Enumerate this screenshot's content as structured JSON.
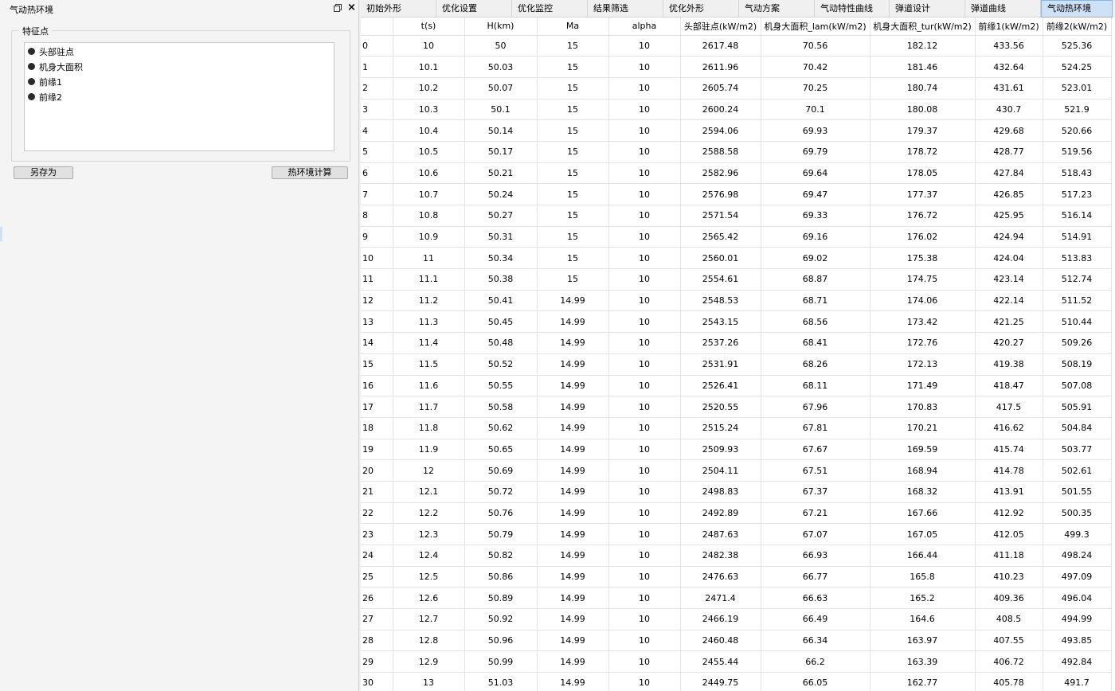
{
  "dock": {
    "title": "气动热环境",
    "group_title": "特征点",
    "items": [
      "头部驻点",
      "机身大面积",
      "前缘1",
      "前缘2"
    ],
    "save_as_label": "另存为",
    "calc_label": "热环境计算"
  },
  "tabs": [
    "初始外形",
    "优化设置",
    "优化监控",
    "结果筛选",
    "优化外形",
    "气动方案",
    "气动特性曲线",
    "弹道设计",
    "弹道曲线",
    "气动热环境"
  ],
  "active_tab": "气动热环境",
  "table": {
    "columns": [
      "",
      "t(s)",
      "H(km)",
      "Ma",
      "alpha",
      "头部驻点(kW/m2)",
      "机身大面积_lam(kW/m2)",
      "机身大面积_tur(kW/m2)",
      "前缘1(kW/m2)",
      "前缘2(kW/m2)"
    ],
    "rows": [
      [
        "0",
        "10",
        "50",
        "15",
        "10",
        "2617.48",
        "70.56",
        "182.12",
        "433.56",
        "525.36"
      ],
      [
        "1",
        "10.1",
        "50.03",
        "15",
        "10",
        "2611.96",
        "70.42",
        "181.46",
        "432.64",
        "524.25"
      ],
      [
        "2",
        "10.2",
        "50.07",
        "15",
        "10",
        "2605.74",
        "70.25",
        "180.74",
        "431.61",
        "523.01"
      ],
      [
        "3",
        "10.3",
        "50.1",
        "15",
        "10",
        "2600.24",
        "70.1",
        "180.08",
        "430.7",
        "521.9"
      ],
      [
        "4",
        "10.4",
        "50.14",
        "15",
        "10",
        "2594.06",
        "69.93",
        "179.37",
        "429.68",
        "520.66"
      ],
      [
        "5",
        "10.5",
        "50.17",
        "15",
        "10",
        "2588.58",
        "69.79",
        "178.72",
        "428.77",
        "519.56"
      ],
      [
        "6",
        "10.6",
        "50.21",
        "15",
        "10",
        "2582.96",
        "69.64",
        "178.05",
        "427.84",
        "518.43"
      ],
      [
        "7",
        "10.7",
        "50.24",
        "15",
        "10",
        "2576.98",
        "69.47",
        "177.37",
        "426.85",
        "517.23"
      ],
      [
        "8",
        "10.8",
        "50.27",
        "15",
        "10",
        "2571.54",
        "69.33",
        "176.72",
        "425.95",
        "516.14"
      ],
      [
        "9",
        "10.9",
        "50.31",
        "15",
        "10",
        "2565.42",
        "69.16",
        "176.02",
        "424.94",
        "514.91"
      ],
      [
        "10",
        "11",
        "50.34",
        "15",
        "10",
        "2560.01",
        "69.02",
        "175.38",
        "424.04",
        "513.83"
      ],
      [
        "11",
        "11.1",
        "50.38",
        "15",
        "10",
        "2554.61",
        "68.87",
        "174.75",
        "423.14",
        "512.74"
      ],
      [
        "12",
        "11.2",
        "50.41",
        "14.99",
        "10",
        "2548.53",
        "68.71",
        "174.06",
        "422.14",
        "511.52"
      ],
      [
        "13",
        "11.3",
        "50.45",
        "14.99",
        "10",
        "2543.15",
        "68.56",
        "173.42",
        "421.25",
        "510.44"
      ],
      [
        "14",
        "11.4",
        "50.48",
        "14.99",
        "10",
        "2537.26",
        "68.41",
        "172.76",
        "420.27",
        "509.26"
      ],
      [
        "15",
        "11.5",
        "50.52",
        "14.99",
        "10",
        "2531.91",
        "68.26",
        "172.13",
        "419.38",
        "508.19"
      ],
      [
        "16",
        "11.6",
        "50.55",
        "14.99",
        "10",
        "2526.41",
        "68.11",
        "171.49",
        "418.47",
        "507.08"
      ],
      [
        "17",
        "11.7",
        "50.58",
        "14.99",
        "10",
        "2520.55",
        "67.96",
        "170.83",
        "417.5",
        "505.91"
      ],
      [
        "18",
        "11.8",
        "50.62",
        "14.99",
        "10",
        "2515.24",
        "67.81",
        "170.21",
        "416.62",
        "504.84"
      ],
      [
        "19",
        "11.9",
        "50.65",
        "14.99",
        "10",
        "2509.93",
        "67.67",
        "169.59",
        "415.74",
        "503.77"
      ],
      [
        "20",
        "12",
        "50.69",
        "14.99",
        "10",
        "2504.11",
        "67.51",
        "168.94",
        "414.78",
        "502.61"
      ],
      [
        "21",
        "12.1",
        "50.72",
        "14.99",
        "10",
        "2498.83",
        "67.37",
        "168.32",
        "413.91",
        "501.55"
      ],
      [
        "22",
        "12.2",
        "50.76",
        "14.99",
        "10",
        "2492.89",
        "67.21",
        "167.66",
        "412.92",
        "500.35"
      ],
      [
        "23",
        "12.3",
        "50.79",
        "14.99",
        "10",
        "2487.63",
        "67.07",
        "167.05",
        "412.05",
        "499.3"
      ],
      [
        "24",
        "12.4",
        "50.82",
        "14.99",
        "10",
        "2482.38",
        "66.93",
        "166.44",
        "411.18",
        "498.24"
      ],
      [
        "25",
        "12.5",
        "50.86",
        "14.99",
        "10",
        "2476.63",
        "66.77",
        "165.8",
        "410.23",
        "497.09"
      ],
      [
        "26",
        "12.6",
        "50.89",
        "14.99",
        "10",
        "2471.4",
        "66.63",
        "165.2",
        "409.36",
        "496.04"
      ],
      [
        "27",
        "12.7",
        "50.92",
        "14.99",
        "10",
        "2466.19",
        "66.49",
        "164.6",
        "408.5",
        "494.99"
      ],
      [
        "28",
        "12.8",
        "50.96",
        "14.99",
        "10",
        "2460.48",
        "66.34",
        "163.97",
        "407.55",
        "493.85"
      ],
      [
        "29",
        "12.9",
        "50.99",
        "14.99",
        "10",
        "2455.44",
        "66.2",
        "163.39",
        "406.72",
        "492.84"
      ],
      [
        "30",
        "13",
        "51.03",
        "14.99",
        "10",
        "2449.75",
        "66.05",
        "162.77",
        "405.78",
        "491.7"
      ]
    ]
  }
}
